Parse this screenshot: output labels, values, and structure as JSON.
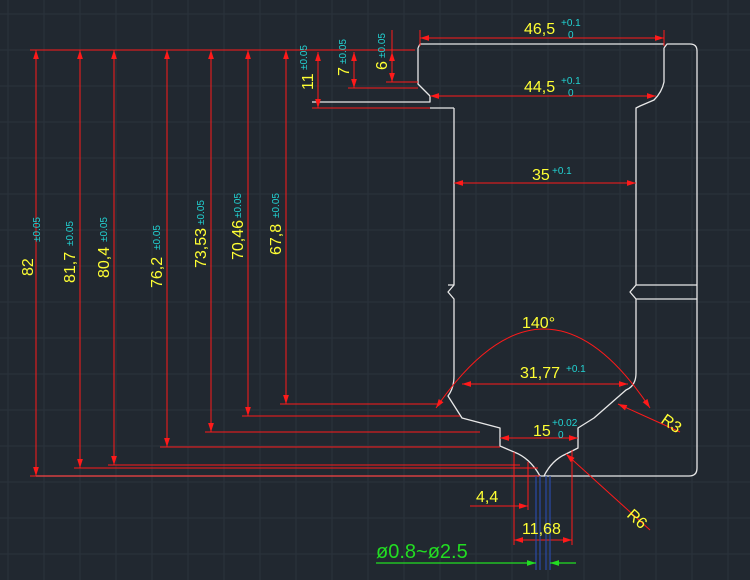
{
  "dimensions": {
    "d82": "82",
    "d82_tol": "±0.05",
    "d817": "81,7",
    "d817_tol": "±0.05",
    "d804": "80,4",
    "d804_tol": "±0.05",
    "d762": "76,2",
    "d762_tol": "±0.05",
    "d7353": "73,53",
    "d7353_tol": "±0.05",
    "d7046": "70,46",
    "d7046_tol": "±0.05",
    "d678": "67,8",
    "d678_tol": "±0.05",
    "d11": "11",
    "d11_tol": "±0.05",
    "d7": "7",
    "d7_tol": "±0.05",
    "d6": "6",
    "d6_tol": "±0.05",
    "w465": "46,5",
    "w465_tol_up": "+0.1",
    "w465_tol_low": "0",
    "w445": "44,5",
    "w445_tol_up": "+0.1",
    "w445_tol_low": "0",
    "w35": "35",
    "w35_tol": "+0.1",
    "angle140": "140°",
    "w3177": "31,77",
    "w3177_tol": "+0.1",
    "r3": "R3",
    "w15": "15",
    "w15_tol_up": "+0.02",
    "w15_tol_low": "0",
    "r6": "R6",
    "w44": "4,4",
    "w1168": "11,68",
    "bore_range": "ø0.8~ø2.5"
  },
  "colors": {
    "background": "#212830",
    "part_outline": "#e8e8e8",
    "dimension_line": "#ff1a1a",
    "dimension_text": "#ffff33",
    "tolerance_text": "#22d3d3",
    "bore_line": "#2a4aa8",
    "bore_label": "#22dd22"
  }
}
